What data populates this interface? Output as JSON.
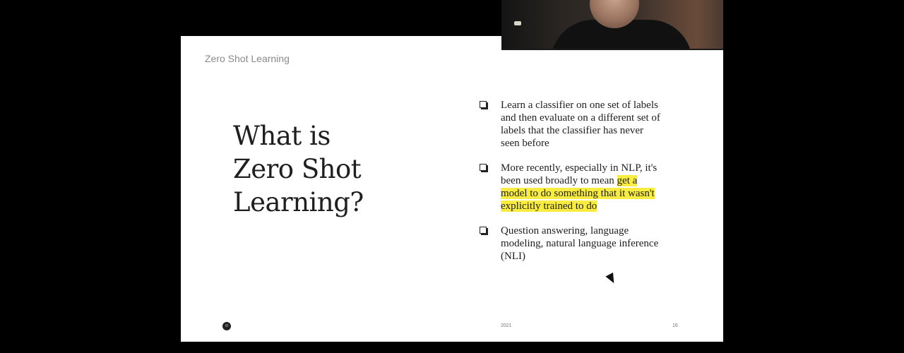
{
  "slide": {
    "header": "Zero Shot Learning",
    "title_lines": [
      "What is",
      "Zero Shot",
      "Learning?"
    ],
    "bullets": [
      {
        "text": "Learn a classifier on one set of labels and then evaluate on a different set of labels that the classifier has never seen before"
      },
      {
        "text_before": "More recently, especially in NLP, it's been used broadly to mean ",
        "highlight": "get a model to do something that it wasn't explicitly trained to do"
      },
      {
        "text": "Question answering, language modeling, natural language inference (NLI)"
      }
    ],
    "footer_year": "2021",
    "footer_page": "16"
  },
  "icons": {
    "bullet": "checkbox-icon",
    "logo": "freddie-logo-icon",
    "cursor": "mouse-cursor-icon"
  },
  "colors": {
    "background": "#000000",
    "slide": "#ffffff",
    "highlight": "#f7ec3f",
    "text": "#1f1f1f"
  }
}
